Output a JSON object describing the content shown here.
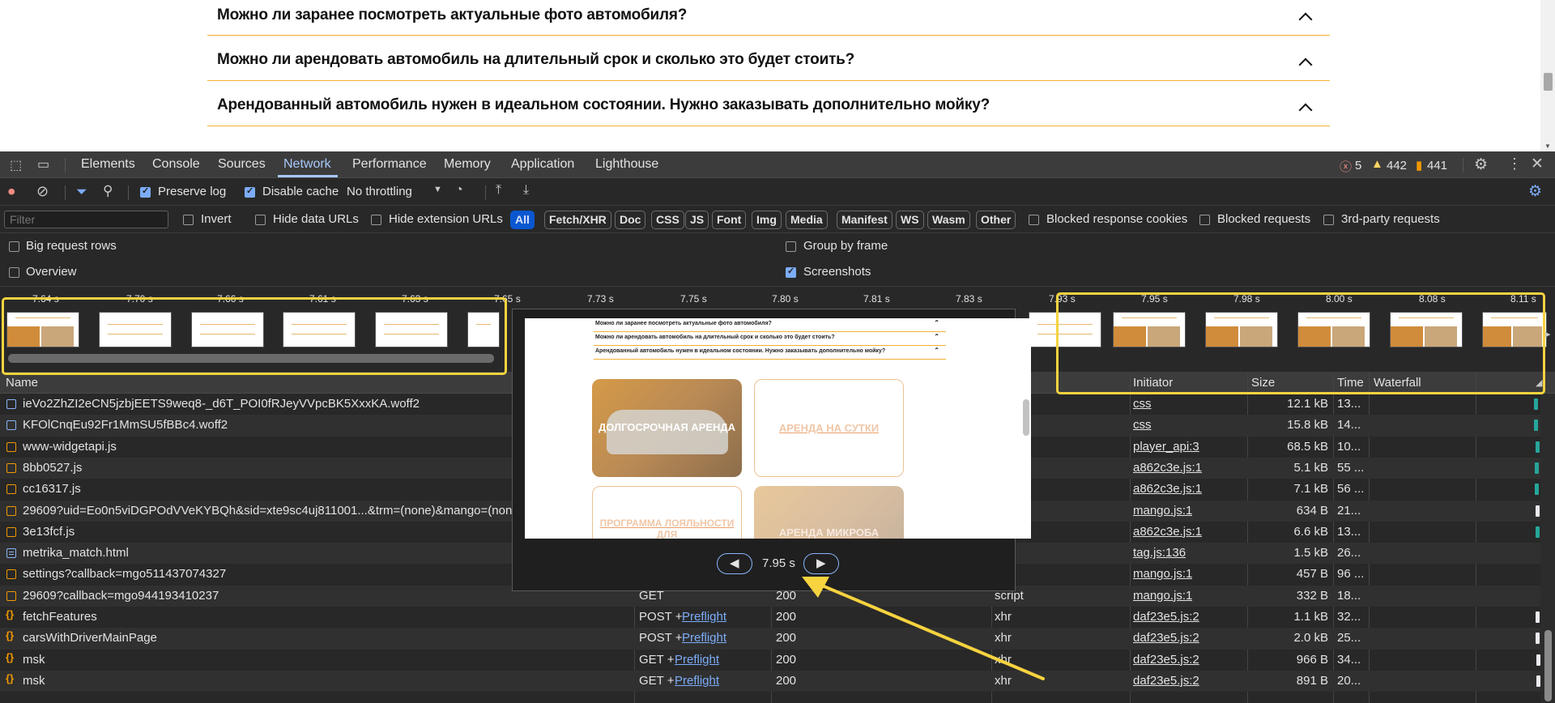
{
  "page": {
    "faq": [
      "Можно ли заранее посмотреть актуальные фото автомобиля?",
      "Можно ли арендовать автомобиль на длительный срок и сколько это будет стоить?",
      "Арендованный автомобиль нужен в идеальном состоянии. Нужно заказывать дополнительно мойку?"
    ]
  },
  "devtools": {
    "tabs": [
      "Elements",
      "Console",
      "Sources",
      "Network",
      "Performance",
      "Memory",
      "Application",
      "Lighthouse"
    ],
    "active_tab": "Network",
    "errors": "5",
    "warnings": "442",
    "issues": "441",
    "colors": {
      "error": "#f28b82",
      "warning": "#fdd663",
      "issue": "#f29900",
      "accent": "#a8c7fa",
      "highlight": "#f6d33f"
    }
  },
  "toolbar": {
    "preserve_log": "Preserve log",
    "disable_cache": "Disable cache",
    "throttling": "No throttling"
  },
  "filterbar": {
    "placeholder": "Filter",
    "invert": "Invert",
    "hide_data_urls": "Hide data URLs",
    "hide_extension_urls": "Hide extension URLs",
    "types": [
      "All",
      "Fetch/XHR",
      "Doc",
      "CSS",
      "JS",
      "Font",
      "Img",
      "Media",
      "Manifest",
      "WS",
      "Wasm",
      "Other"
    ],
    "blocked_cookies": "Blocked response cookies",
    "blocked_requests": "Blocked requests",
    "third_party": "3rd-party requests"
  },
  "options": {
    "big_rows": "Big request rows",
    "overview": "Overview",
    "group_by_frame": "Group by frame",
    "screenshots": "Screenshots"
  },
  "timeline": {
    "ticks": [
      "7.64 s",
      "7.70 s",
      "7.66 s",
      "7.61 s",
      "7.63 s",
      "7.65 s",
      "7.73 s",
      "7.75 s",
      "7.80 s",
      "7.81 s",
      "7.83 s",
      "7.93 s",
      "7.95 s",
      "7.98 s",
      "8.00 s",
      "8.08 s",
      "8.11 s"
    ]
  },
  "table": {
    "headers": {
      "name": "Name",
      "initiator": "Initiator",
      "size": "Size",
      "time": "Time",
      "waterfall": "Waterfall"
    },
    "rows": [
      {
        "name": "ieVo2ZhZI2eCN5jzbjEETS9weq8-_d6T_POI0fRJeyVVpcBK5XxxKA.woff2",
        "icon": "font",
        "method": "",
        "status": "",
        "type": "",
        "initiator": "css",
        "size": "12.1 kB",
        "time": "13..."
      },
      {
        "name": "KFOlCnqEu92Fr1MmSU5fBBc4.woff2",
        "icon": "font",
        "method": "",
        "status": "",
        "type": "",
        "initiator": "css",
        "size": "15.8 kB",
        "time": "14..."
      },
      {
        "name": "www-widgetapi.js",
        "icon": "js",
        "method": "",
        "status": "",
        "type": "",
        "initiator": "player_api:3",
        "size": "68.5 kB",
        "time": "10..."
      },
      {
        "name": "8bb0527.js",
        "icon": "js",
        "method": "",
        "status": "",
        "type": "",
        "initiator": "a862c3e.js:1",
        "size": "5.1 kB",
        "time": "55 ..."
      },
      {
        "name": "cc16317.js",
        "icon": "js",
        "method": "",
        "status": "",
        "type": "",
        "initiator": "a862c3e.js:1",
        "size": "7.1 kB",
        "time": "56 ..."
      },
      {
        "name": "29609?uid=Eo0n5viDGPOdVVeKYBQh&sid=xte9sc4uj811001...&trm=(none)&mango=(none",
        "icon": "js",
        "method": "",
        "status": "",
        "type": "",
        "initiator": "mango.js:1",
        "size": "634 B",
        "time": "21..."
      },
      {
        "name": "3e13fcf.js",
        "icon": "js",
        "method": "",
        "status": "",
        "type": "",
        "initiator": "a862c3e.js:1",
        "size": "6.6 kB",
        "time": "13..."
      },
      {
        "name": "metrika_match.html",
        "icon": "doc",
        "method": "",
        "status": "",
        "type": "nt",
        "initiator": "tag.js:136",
        "size": "1.5 kB",
        "time": "26..."
      },
      {
        "name": "settings?callback=mgo511437074327",
        "icon": "js",
        "method": "",
        "status": "",
        "type": "",
        "initiator": "mango.js:1",
        "size": "457 B",
        "time": "96 ..."
      },
      {
        "name": "29609?callback=mgo944193410237",
        "icon": "js",
        "method": "GET",
        "preflight": "",
        "status": "200",
        "type": "script",
        "initiator": "mango.js:1",
        "size": "332 B",
        "time": "18..."
      },
      {
        "name": "fetchFeatures",
        "icon": "xhr",
        "method": "POST + ",
        "preflight": "Preflight",
        "status": "200",
        "type": "xhr",
        "initiator": "daf23e5.js:2",
        "size": "1.1 kB",
        "time": "32..."
      },
      {
        "name": "carsWithDriverMainPage",
        "icon": "xhr",
        "method": "POST + ",
        "preflight": "Preflight",
        "status": "200",
        "type": "xhr",
        "initiator": "daf23e5.js:2",
        "size": "2.0 kB",
        "time": "25..."
      },
      {
        "name": "msk",
        "icon": "xhr",
        "method": "GET + ",
        "preflight": "Preflight",
        "status": "200",
        "type": "xhr",
        "initiator": "daf23e5.js:2",
        "size": "966 B",
        "time": "34..."
      },
      {
        "name": "msk",
        "icon": "xhr",
        "method": "GET + ",
        "preflight": "Preflight",
        "status": "200",
        "type": "xhr",
        "initiator": "daf23e5.js:2",
        "size": "891 B",
        "time": "20..."
      }
    ]
  },
  "popup": {
    "time": "7.95 s",
    "preview_faq": [
      "Можно ли заранее посмотреть актуальные фото автомобиля?",
      "Можно ли арендовать автомобиль на длительный срок и сколько это будет стоить?",
      "Арендованный автомобиль нужен в идеальном состоянии. Нужно заказывать дополнительно мойку?"
    ],
    "cards": [
      "ДОЛГОСРОЧНАЯ АРЕНДА",
      "АРЕНДА НА СУТКИ",
      "ПРОГРАММА ЛОЯЛЬНОСТИ ДЛЯ",
      "АРЕНДА МИКРОБА"
    ]
  }
}
